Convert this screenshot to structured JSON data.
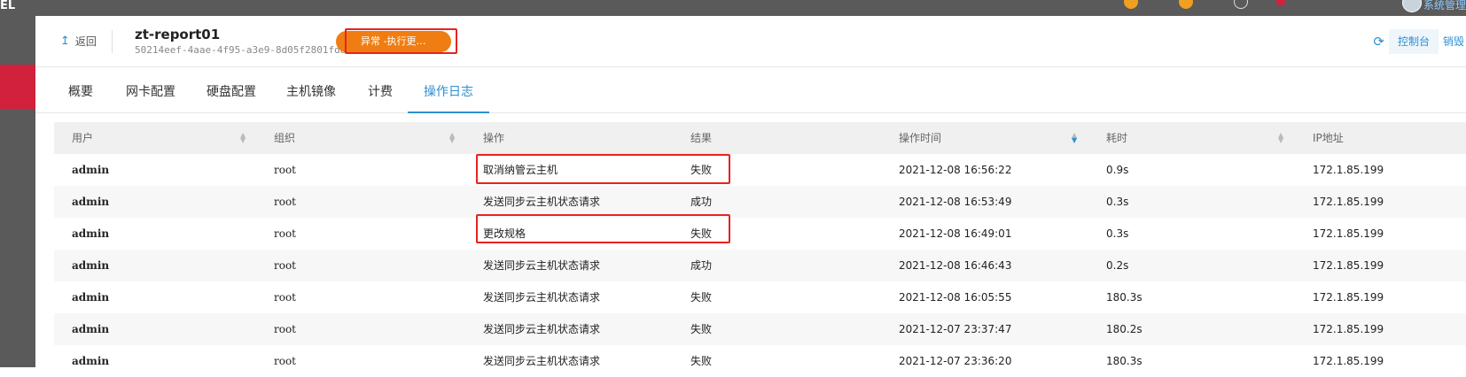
{
  "topbar": {
    "brand": "EL",
    "user_label": "系统管理"
  },
  "header": {
    "back_label": "返回",
    "vm_name": "zt-report01",
    "vm_uuid": "50214eef-4aae-4f95-a3e9-8d05f2801fdd",
    "status": "异常 -执行更…",
    "console_label": "控制台",
    "destroy_label": "销毁"
  },
  "tabs": [
    {
      "label": "概要"
    },
    {
      "label": "网卡配置"
    },
    {
      "label": "硬盘配置"
    },
    {
      "label": "主机镜像"
    },
    {
      "label": "计费"
    },
    {
      "label": "操作日志",
      "active": true
    }
  ],
  "table": {
    "columns": [
      "用户",
      "组织",
      "操作",
      "结果",
      "操作时间",
      "耗时",
      "IP地址"
    ],
    "rows": [
      {
        "user": "admin",
        "org": "root",
        "op": "取消纳管云主机",
        "result": "失败",
        "time": "2021-12-08 16:56:22",
        "dur": "0.9s",
        "ip": "172.1.85.199"
      },
      {
        "user": "admin",
        "org": "root",
        "op": "发送同步云主机状态请求",
        "result": "成功",
        "time": "2021-12-08 16:53:49",
        "dur": "0.3s",
        "ip": "172.1.85.199"
      },
      {
        "user": "admin",
        "org": "root",
        "op": "更改规格",
        "result": "失败",
        "time": "2021-12-08 16:49:01",
        "dur": "0.3s",
        "ip": "172.1.85.199"
      },
      {
        "user": "admin",
        "org": "root",
        "op": "发送同步云主机状态请求",
        "result": "成功",
        "time": "2021-12-08 16:46:43",
        "dur": "0.2s",
        "ip": "172.1.85.199"
      },
      {
        "user": "admin",
        "org": "root",
        "op": "发送同步云主机状态请求",
        "result": "失败",
        "time": "2021-12-08 16:05:55",
        "dur": "180.3s",
        "ip": "172.1.85.199"
      },
      {
        "user": "admin",
        "org": "root",
        "op": "发送同步云主机状态请求",
        "result": "失败",
        "time": "2021-12-07 23:37:47",
        "dur": "180.2s",
        "ip": "172.1.85.199"
      },
      {
        "user": "admin",
        "org": "root",
        "op": "发送同步云主机状态请求",
        "result": "失败",
        "time": "2021-12-07 23:36:20",
        "dur": "180.3s",
        "ip": "172.1.85.199"
      }
    ]
  },
  "colors": {
    "accent": "#2f8fd0",
    "status_orange": "#f07d11",
    "highlight_red": "#e8231f",
    "sidebar_active": "#d1213c"
  }
}
